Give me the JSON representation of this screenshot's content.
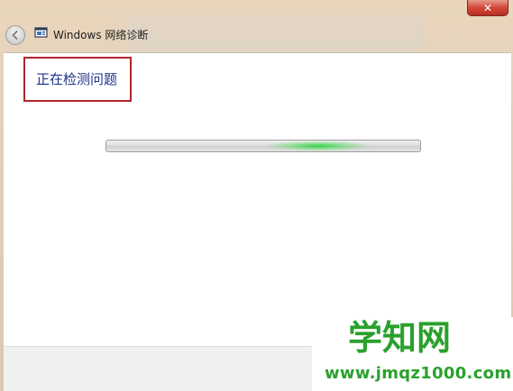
{
  "window": {
    "title": "Windows 网络诊断",
    "close_label": "✕"
  },
  "main": {
    "status_heading": "正在检测问题",
    "progress": {
      "state": "indeterminate",
      "accent_color": "#2cd640"
    },
    "highlight_color": "#b0262b"
  },
  "watermark": {
    "logo": "学知网",
    "url": "www.jmqz1000.com",
    "color": "#2aa12c"
  },
  "icons": {
    "back": "back-arrow-icon",
    "app": "network-diagnostics-icon"
  }
}
